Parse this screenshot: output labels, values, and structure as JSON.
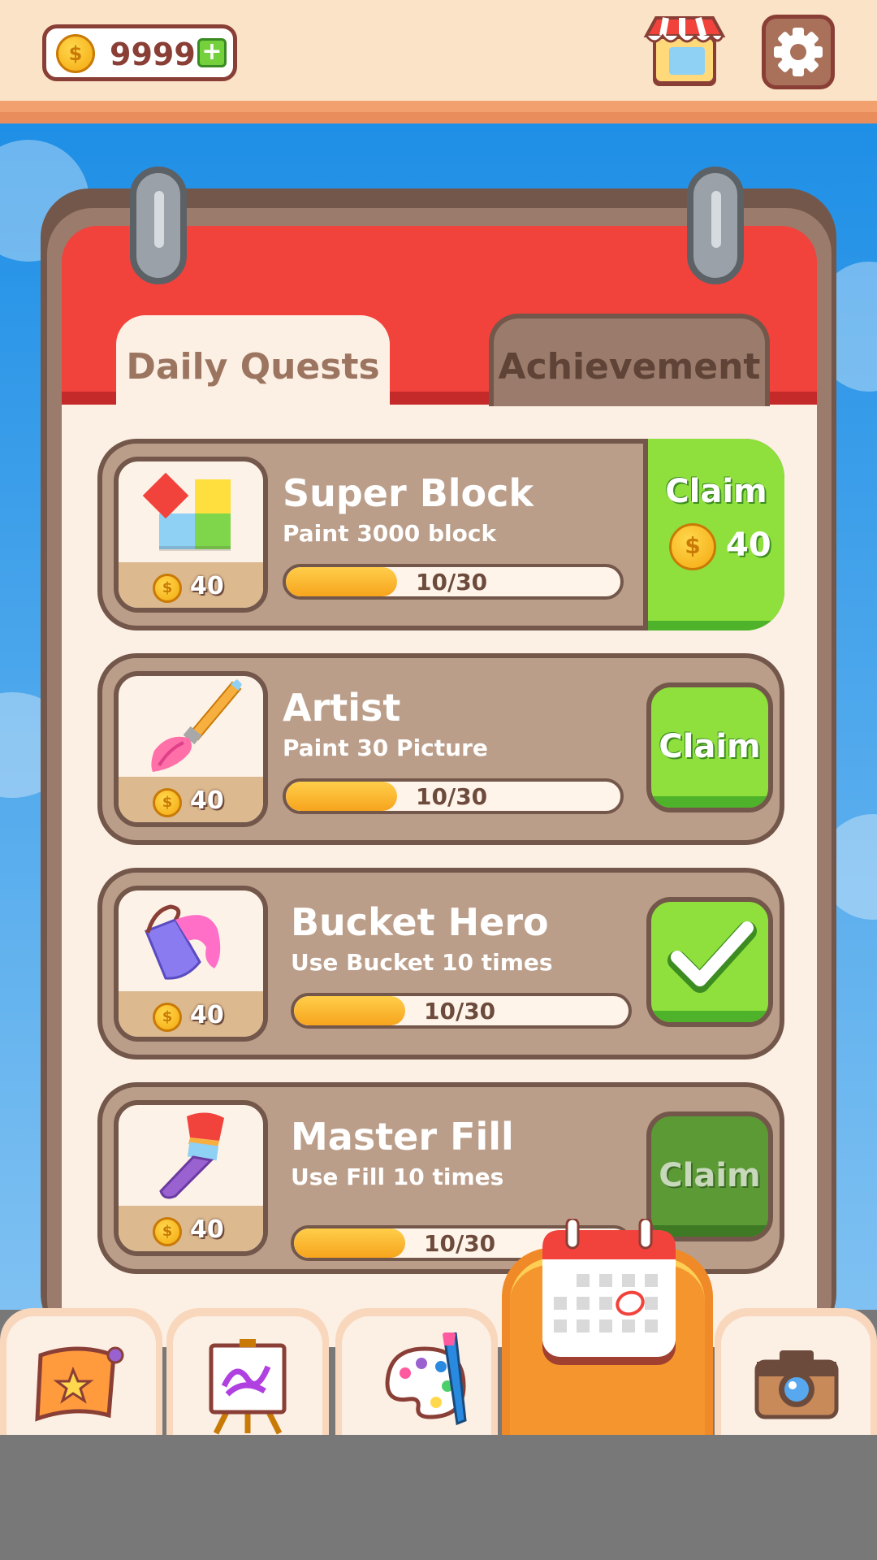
{
  "header": {
    "coins": "9999",
    "add_coins_icon": "plus-icon",
    "shop_icon": "shop-icon",
    "settings_icon": "gear-icon"
  },
  "tabs": {
    "daily": "Daily Quests",
    "achievement": "Achievement",
    "active": "daily"
  },
  "quests": [
    {
      "title": "Super Block",
      "desc": "Paint 3000 block",
      "reward": "40",
      "progress": "10/30",
      "progress_fraction": 0.333,
      "icon": "blocks-icon",
      "button": "Claim",
      "button_reward": "40",
      "state": "claimable-with-reward"
    },
    {
      "title": "Artist",
      "desc": "Paint 30 Picture",
      "reward": "40",
      "progress": "10/30",
      "progress_fraction": 0.333,
      "icon": "paintbrush-icon",
      "button": "Claim",
      "state": "claimable"
    },
    {
      "title": "Bucket Hero",
      "desc": "Use Bucket 10 times",
      "reward": "40",
      "progress": "10/30",
      "progress_fraction": 0.333,
      "icon": "paint-bucket-icon",
      "state": "completed"
    },
    {
      "title": "Master Fill",
      "desc": "Use Fill 10 times",
      "reward": "40",
      "progress": "10/30",
      "progress_fraction": 0.333,
      "icon": "fill-brush-icon",
      "button": "Claim",
      "state": "disabled"
    }
  ],
  "nav": [
    {
      "icon": "scroll-map-icon"
    },
    {
      "icon": "easel-icon"
    },
    {
      "icon": "palette-icon"
    },
    {
      "icon": "calendar-icon",
      "active": true
    },
    {
      "icon": "camera-icon"
    }
  ],
  "colors": {
    "accent_green": "#8fe03c",
    "board_red": "#f2423c",
    "brown": "#73574a",
    "card": "#bb9e89",
    "progress": "#f7a41d"
  }
}
